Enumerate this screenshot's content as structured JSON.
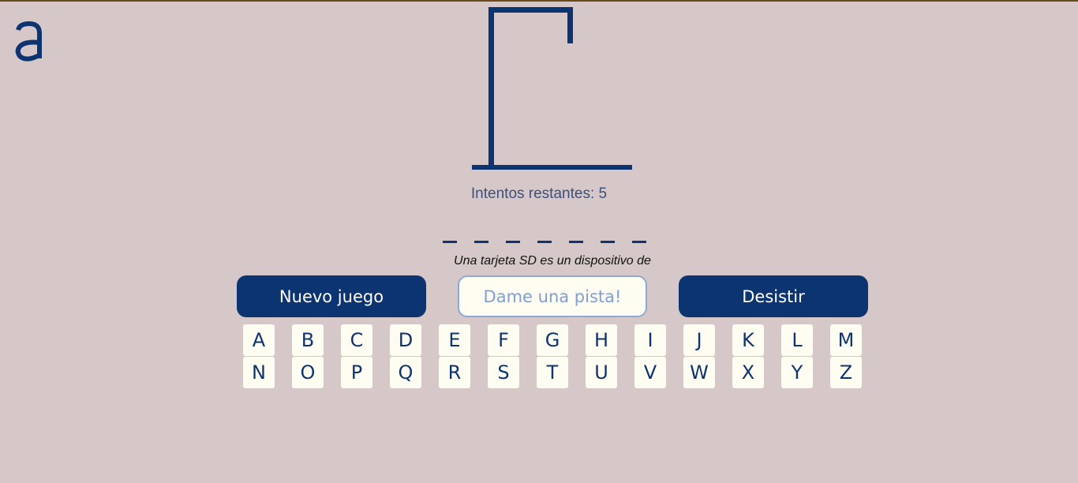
{
  "logo": {
    "name": "a-logo-icon",
    "color": "#0c3470",
    "letter": "a"
  },
  "colors": {
    "background": "#d6c8c8",
    "primary": "#0c3470",
    "key_bg": "#fffcf2",
    "hint_border": "#8aa8d8"
  },
  "game": {
    "attempts_text": "Intentos restantes: 5",
    "word_length": 7,
    "hint_text": "Una tarjeta SD es un dispositivo de"
  },
  "buttons": {
    "new_game": "Nuevo juego",
    "get_hint": "Dame una pista!",
    "give_up": "Desistir"
  },
  "keyboard": {
    "row1": [
      "A",
      "B",
      "C",
      "D",
      "E",
      "F",
      "G",
      "H",
      "I",
      "J",
      "K",
      "L",
      "M"
    ],
    "row2": [
      "N",
      "O",
      "P",
      "Q",
      "R",
      "S",
      "T",
      "U",
      "V",
      "W",
      "X",
      "Y",
      "Z"
    ]
  }
}
